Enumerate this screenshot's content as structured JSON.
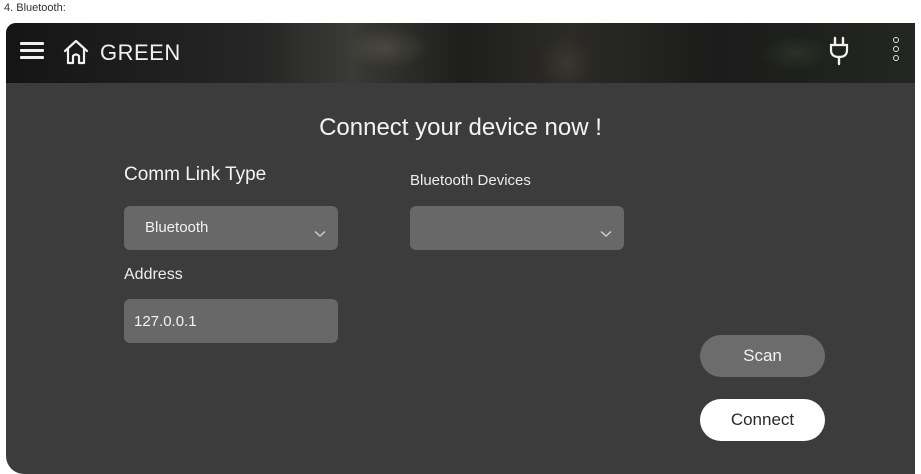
{
  "document": {
    "caption": "4. Bluetooth:"
  },
  "header": {
    "title": "GREEN",
    "icons": {
      "menu": "hamburger-menu-icon",
      "home": "home-icon",
      "power": "plug-icon",
      "more": "kebab-menu-icon"
    }
  },
  "main": {
    "headline": "Connect your device now !",
    "comm_link": {
      "label": "Comm Link Type",
      "selected": "Bluetooth"
    },
    "bluetooth_devices": {
      "label": "Bluetooth Devices",
      "selected": ""
    },
    "address": {
      "label": "Address",
      "value": "127.0.0.1"
    },
    "buttons": {
      "scan": "Scan",
      "connect": "Connect"
    }
  },
  "colors": {
    "panel_background": "#3c3c3c",
    "field_background": "#686868",
    "scan_button": "#6c6c6c",
    "connect_button": "#ffffff",
    "text": "#f2f2f2"
  }
}
